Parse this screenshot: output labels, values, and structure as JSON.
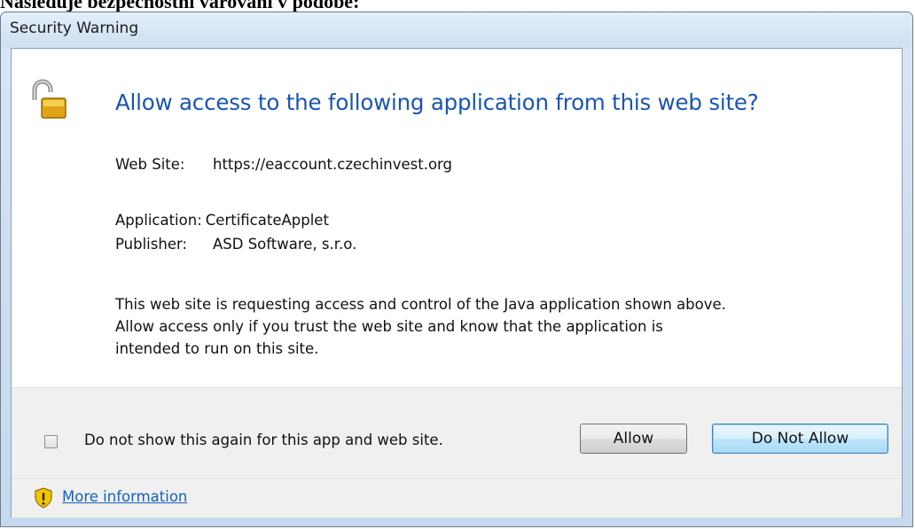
{
  "document": {
    "heading": "Následuje bezpečnostní varování v podobě:"
  },
  "dialog": {
    "title": "Security Warning",
    "icon": "padlock-open-icon",
    "headline": "Allow access to the following application from this web site?",
    "web_site": {
      "label": "Web Site:",
      "value": "https://eaccount.czechinvest.org"
    },
    "application": {
      "label": "Application:",
      "value": "CertificateApplet"
    },
    "publisher": {
      "label": "Publisher:",
      "value": "ASD Software, s.r.o."
    },
    "description": [
      "This web site is requesting access and control of the Java application shown above.",
      "Allow access only if you trust the web site and know that the application is",
      "intended to run on this site."
    ],
    "checkbox": {
      "label": "Do not show this again for this app and web site.",
      "checked": false
    },
    "buttons": {
      "allow": "Allow",
      "deny": "Do Not Allow"
    },
    "footer": {
      "icon": "shield-warning-icon",
      "link": "More information"
    },
    "colors": {
      "headline": "#1a55b3",
      "link": "#1560bd",
      "padlock": "#e0a516"
    }
  }
}
